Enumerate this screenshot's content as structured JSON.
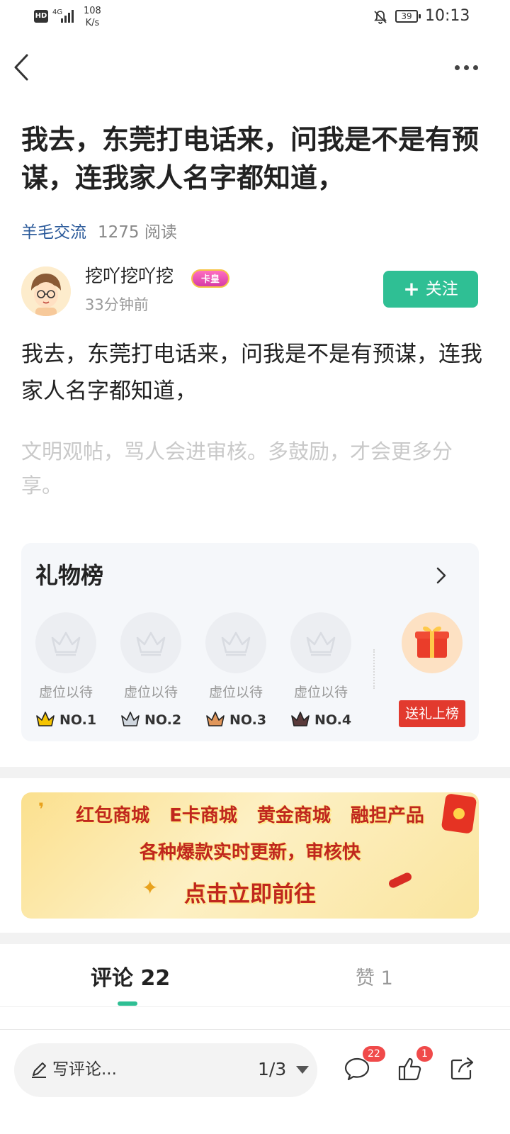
{
  "status_bar": {
    "network": "HD",
    "network_type": "4G",
    "speed_value": "108",
    "speed_unit": "K/s",
    "battery": "39",
    "time": "10:13"
  },
  "post": {
    "title": "我去，东莞打电话来，问我是不是有预谋，连我家人名字都知道，",
    "category": "羊毛交流",
    "reads": "1275 阅读",
    "author_name": "挖吖挖吖挖",
    "author_badge": "卡皇",
    "posted_ago": "33分钟前",
    "follow_label": "关注",
    "follow_plus": "+",
    "content": "我去，东莞打电话来，问我是不是有预谋，连我家人名字都知道，",
    "hint": "文明观帖，骂人会进审核。多鼓励，才会更多分享。"
  },
  "gift_board": {
    "title": "礼物榜",
    "slots": [
      {
        "label": "虚位以待",
        "rank": "NO.1"
      },
      {
        "label": "虚位以待",
        "rank": "NO.2"
      },
      {
        "label": "虚位以待",
        "rank": "NO.3"
      },
      {
        "label": "虚位以待",
        "rank": "NO.4"
      }
    ],
    "send_label": "送礼上榜"
  },
  "banner": {
    "items": [
      "红包商城",
      "E卡商城",
      "黄金商城",
      "融担产品"
    ],
    "line2": "各种爆款实时更新，审核快",
    "cta": "点击立即前往"
  },
  "tabs": {
    "comments": "评论 22",
    "likes": "赞 1"
  },
  "bottom_bar": {
    "comment_placeholder": "写评论...",
    "page_indicator": "1/3",
    "comment_count": "22",
    "like_count": "1"
  },
  "colors": {
    "accent": "#2fbf94",
    "category_link": "#2b5a9a",
    "badge_red": "#f04a4a",
    "send_gift_red": "#e23a2e"
  },
  "icons": [
    "back-icon",
    "more-icon",
    "crown-icon",
    "gift-icon",
    "chevron-right-icon",
    "pencil-icon",
    "comment-icon",
    "thumbs-up-icon",
    "share-icon",
    "bell-off-icon",
    "battery-icon",
    "signal-icon"
  ]
}
